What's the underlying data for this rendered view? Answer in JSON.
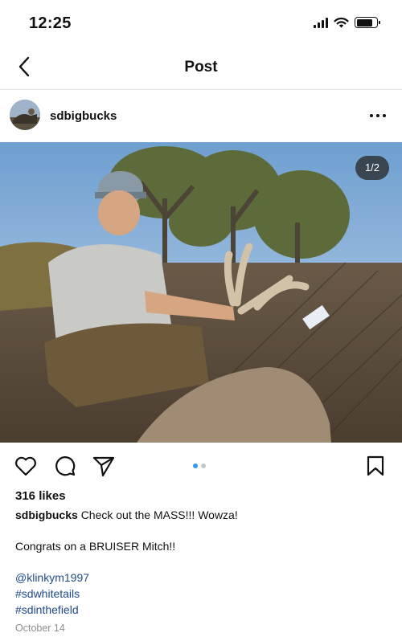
{
  "status_bar": {
    "time": "12:25",
    "icons": [
      "cellular-signal-icon",
      "wifi-icon",
      "battery-icon"
    ],
    "battery_level": 0.8
  },
  "header": {
    "title": "Post",
    "back_icon": "chevron-left-icon"
  },
  "post": {
    "username": "sdbigbucks",
    "more_icon": "more-horizontal-icon",
    "photo_counter": "1/2",
    "carousel_dots": 2,
    "carousel_active_index": 0,
    "likes": "316 likes",
    "caption_user": "sdbigbucks",
    "caption_text": "Check out the MASS!!! Wowza!",
    "comment_line": "Congrats on a BRUISER Mitch!!",
    "mention": "@klinkym1997",
    "hashtags": [
      "#sdwhitetails",
      "#sdinthefield"
    ],
    "date": "October 14"
  },
  "actions": {
    "icons": [
      "heart-icon",
      "comment-icon",
      "share-icon",
      "bookmark-icon"
    ]
  },
  "colors": {
    "accent_blue": "#3897f0",
    "link_blue": "#1f4a8a",
    "inactive_dot": "#c7c7c7",
    "muted_text": "#8e8e8e"
  }
}
